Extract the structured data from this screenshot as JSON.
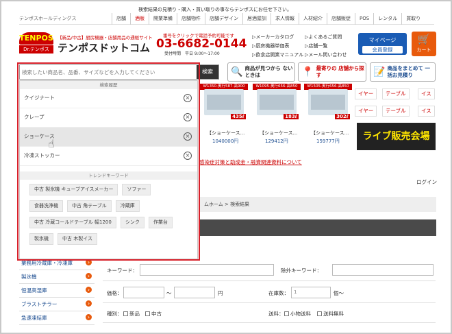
{
  "notice": "検索結果の見積り・購入・買い取りの事ならテンポスにお任せ下さい。",
  "company": "テンポスホールディングス",
  "nav": [
    "店舗",
    "酒販",
    "開業準備",
    "店舗物件",
    "店舗デザイン",
    "居酒屋訓",
    "求人情報",
    "人材紹介",
    "店舗販促",
    "POS",
    "レンタル",
    "買取り"
  ],
  "logo": {
    "top": "TENPOS",
    "bottom": "Dr.テンポス"
  },
  "site": {
    "subtitle": "【新品/中古】厨房機器・店舗用品の通販サイト",
    "name": "テンポスドットコム"
  },
  "phone": {
    "label": "番号をクリックで電話予約可能です",
    "number": "03-6682-0144",
    "hours": "受付時間　平日 9:00〜17:00"
  },
  "header_links": {
    "col1": [
      "メーカーカタログ",
      "厨房機器単価表",
      "飲食店開業マニュアル"
    ],
    "col2": [
      "よくあるご質問",
      "店舗一覧",
      "メール問い合わせ"
    ]
  },
  "mypage": {
    "label": "マイページ",
    "register": "会員登録"
  },
  "cart": {
    "label": "カート"
  },
  "search": {
    "placeholder": "検索したい商品名、品番、サイズなどを入力してください",
    "button": "検索"
  },
  "features": [
    {
      "label": "商品が見つから ないときは"
    },
    {
      "label": "最寄りの 店舗から探す"
    },
    {
      "label": "商品をまとめて 一括お見積り"
    }
  ],
  "dropdown": {
    "history_title": "検索履歴",
    "history": [
      "クイジナート",
      "クレープ",
      "ショーケース",
      "冷凍ストッカー"
    ],
    "trend_title": "トレンドキーワード",
    "trends": [
      "中古 製氷機 キューブアイスメーカー",
      "ソファー",
      "食器洗浄機",
      "中古 角テーブル",
      "冷蔵庫",
      "中古 冷蔵コールドテーブル 幅1200",
      "シンク",
      "作業台",
      "製氷機",
      "中古 木製イス"
    ]
  },
  "products": [
    {
      "title": "【ショーケース...",
      "price": "1040000円",
      "ribbon": "W1350-奥行587-高900",
      "badge": "435ℓ"
    },
    {
      "title": "【ショーケース...",
      "price": "129412円",
      "ribbon": "W1095-奥行656-高850",
      "badge": "183ℓ"
    },
    {
      "title": "【ショーケース...",
      "price": "159777円",
      "ribbon": "W1505-奥行656-高850",
      "badge": "302ℓ"
    }
  ],
  "categories": [
    "イヤー",
    "テーブル",
    "イス",
    "イヤー",
    "テーブル",
    "イス"
  ],
  "banner": "ライブ販売会場",
  "alert": "感染症対策と助成金・融資関連資料について",
  "login": "ログイン",
  "breadcrumb": "ムホーム > 検索結果",
  "sidebar": [
    "業務用冷蔵庫・冷凍庫",
    "製氷機",
    "恒温高湿庫",
    "ブラストチラー",
    "急速凍結庫"
  ],
  "form": {
    "keyword": "キーワード：",
    "exclude": "除外キーワード：",
    "price": "価格：",
    "tilde": "〜",
    "yen": "円",
    "stock": "在庫数：",
    "stock_value": "1",
    "unit": "個〜",
    "kind": "種別：",
    "new": "新品",
    "used": "中古",
    "shipping": "送料：",
    "small": "小物送料",
    "free": "送料無料"
  }
}
